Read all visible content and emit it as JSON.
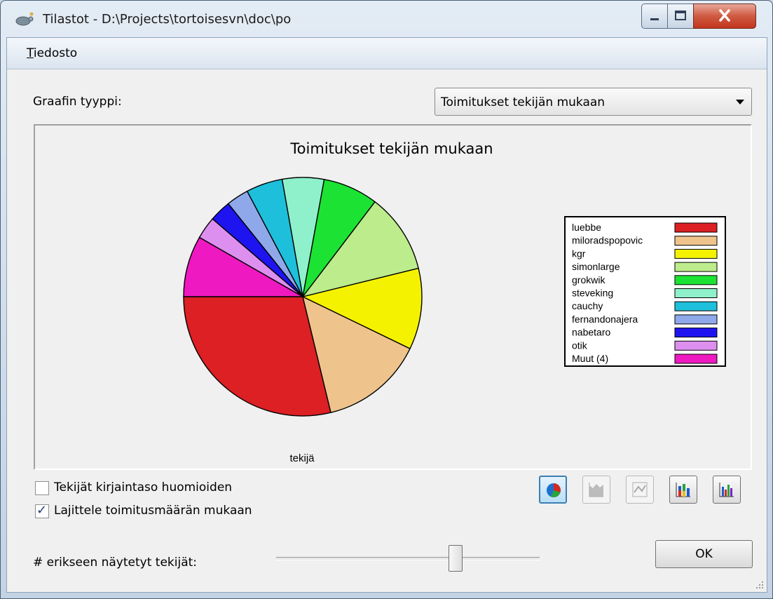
{
  "window": {
    "title": "Tilastot - D:\\Projects\\tortoisesvn\\doc\\po"
  },
  "menu": {
    "file_accel": "T",
    "file_rest": "iedosto"
  },
  "graph_type": {
    "label": "Graafin tyyppi:",
    "selected": "Toimitukset tekijän mukaan"
  },
  "options": {
    "case_sensitive": {
      "label": "Tekijät kirjaintaso huomioiden",
      "checked": false
    },
    "sort_by_commits": {
      "label": "Lajittele toimitusmäärän mukaan",
      "checked": true
    }
  },
  "slider": {
    "label": "# erikseen näytetyt tekijät:",
    "value_fraction": 0.68
  },
  "ok_label": "OK",
  "chart_data": {
    "type": "pie",
    "title": "Toimitukset tekijän mukaan",
    "xlabel": "tekijä",
    "legend_position": "right",
    "categories": [
      "luebbe",
      "miloradspopovic",
      "kgr",
      "simonlarge",
      "grokwik",
      "steveking",
      "cauchy",
      "fernandonajera",
      "nabetaro",
      "otik",
      "Muut (4)"
    ],
    "values": [
      28.5,
      13.9,
      10.9,
      10.7,
      7.4,
      5.6,
      4.9,
      3.0,
      2.9,
      3.0,
      8.2
    ],
    "colors": [
      "#dc2023",
      "#eec48c",
      "#f5f200",
      "#bcec8b",
      "#1ce333",
      "#8ff1cb",
      "#1ebfdb",
      "#8ea8ea",
      "#1e14f0",
      "#dd8ff0",
      "#ef19c1"
    ]
  }
}
